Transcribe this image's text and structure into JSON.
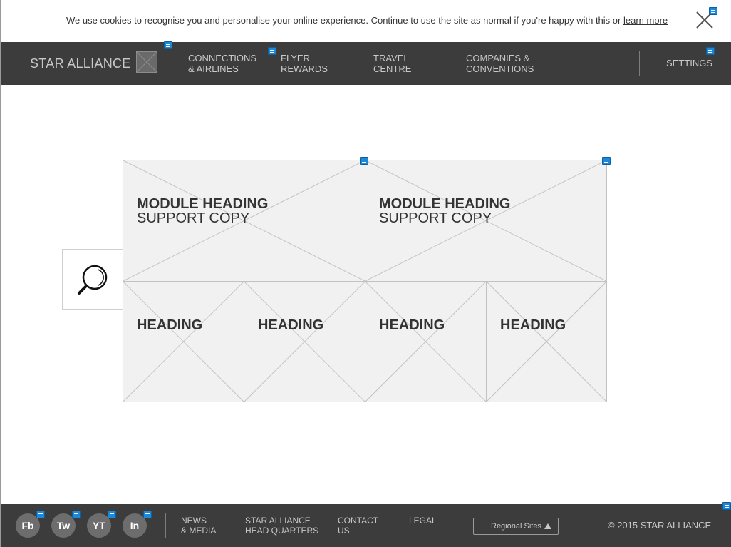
{
  "cookie_bar": {
    "message": "We use cookies to recognise you and personalise your online experience. Continue to use the site as normal if you're happy with this or",
    "link": "learn more"
  },
  "header": {
    "brand": "STAR ALLIANCE",
    "nav": [
      {
        "line1": "CONNECTIONS",
        "line2": "& AIRLINES"
      },
      {
        "line1": "FLYER",
        "line2": "REWARDS"
      },
      {
        "line1": "TRAVEL",
        "line2": "CENTRE"
      },
      {
        "line1": "COMPANIES &",
        "line2": "CONVENTIONS"
      }
    ],
    "settings": "SETTINGS"
  },
  "modules": {
    "large": [
      {
        "heading": "MODULE HEADING",
        "copy": "SUPPORT COPY"
      },
      {
        "heading": "MODULE HEADING",
        "copy": "SUPPORT COPY"
      }
    ],
    "small": [
      {
        "heading": "HEADING"
      },
      {
        "heading": "HEADING"
      },
      {
        "heading": "HEADING"
      },
      {
        "heading": "HEADING"
      }
    ]
  },
  "footer": {
    "social": [
      "Fb",
      "Tw",
      "YT",
      "In"
    ],
    "links": [
      {
        "line1": "NEWS",
        "line2": "& MEDIA"
      },
      {
        "line1": "STAR ALLIANCE",
        "line2": "HEAD QUARTERS"
      },
      {
        "line1": "CONTACT",
        "line2": "US"
      },
      {
        "line1": "LEGAL",
        "line2": ""
      }
    ],
    "regional_sites": "Regional Sites",
    "copyright": "© 2015 STAR ALLIANCE"
  }
}
